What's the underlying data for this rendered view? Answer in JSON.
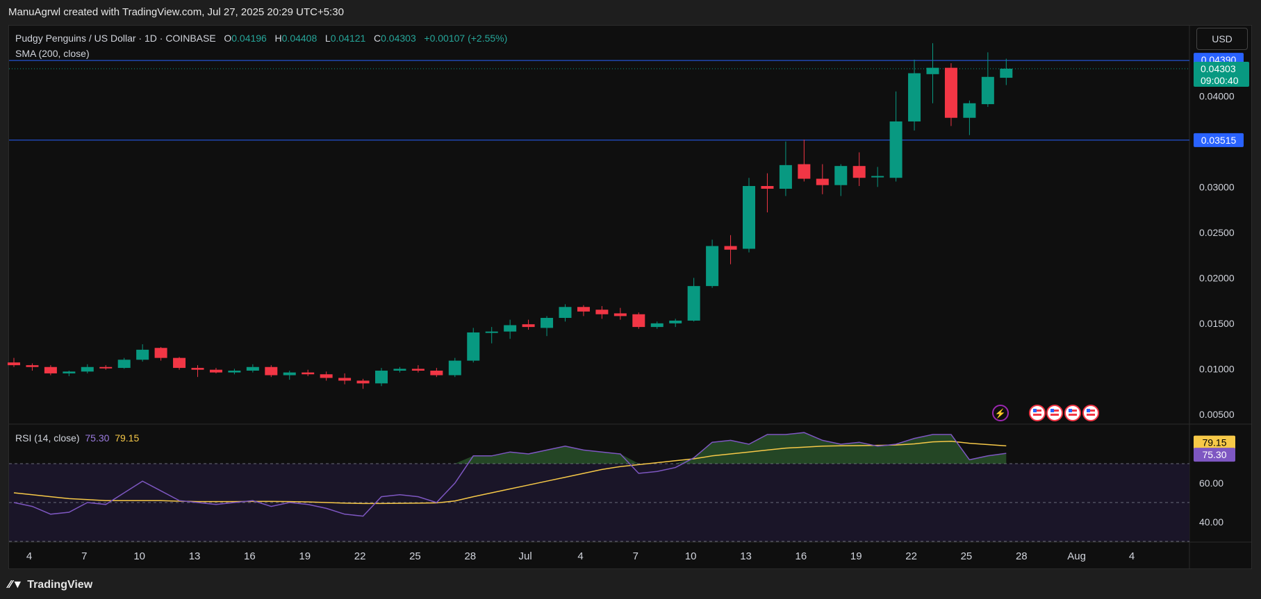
{
  "header": {
    "attribution": "ManuAgrwl created with TradingView.com, Jul 27, 2025 20:29 UTC+5:30"
  },
  "legend": {
    "symbol": "Pudgy Penguins / US Dollar · 1D · COINBASE",
    "o_label": "O",
    "o": "0.04196",
    "h_label": "H",
    "h": "0.04408",
    "l_label": "L",
    "l": "0.04121",
    "c_label": "C",
    "c": "0.04303",
    "change": "+0.00107 (+2.55%)",
    "sma": "SMA (200, close)"
  },
  "currency_button": "USD",
  "rsi_legend": {
    "label": "RSI (14, close)",
    "rsi": "75.30",
    "ma": "79.15"
  },
  "footer": {
    "brand": "TradingView"
  },
  "colors": {
    "up": "#089981",
    "down": "#f23645",
    "rsi_line": "#7e57c2",
    "rsi_ma": "#f7c948",
    "hline": "#2962ff"
  },
  "chart_data": [
    {
      "type": "candlestick",
      "x_ticks": [
        "4",
        "7",
        "10",
        "13",
        "16",
        "19",
        "22",
        "25",
        "28",
        "Jul",
        "4",
        "7",
        "10",
        "13",
        "16",
        "19",
        "22",
        "25",
        "28",
        "Aug",
        "4"
      ],
      "y_ticks": [
        "0.00500",
        "0.01000",
        "0.01500",
        "0.02000",
        "0.02500",
        "0.03000",
        "0.04000"
      ],
      "ylim": [
        0.004,
        0.0475
      ],
      "price_labels": {
        "level_high": "0.04390",
        "last": "0.04303",
        "countdown": "09:00:40",
        "level_low": "0.03515"
      },
      "horizontal_lines": [
        0.0439,
        0.03515
      ],
      "candles": [
        {
          "o": 0.0107,
          "h": 0.0112,
          "l": 0.0102,
          "c": 0.0104
        },
        {
          "o": 0.0104,
          "h": 0.0106,
          "l": 0.0098,
          "c": 0.0102
        },
        {
          "o": 0.0102,
          "h": 0.0104,
          "l": 0.0093,
          "c": 0.0095
        },
        {
          "o": 0.0095,
          "h": 0.0098,
          "l": 0.0092,
          "c": 0.0097
        },
        {
          "o": 0.0097,
          "h": 0.0105,
          "l": 0.0095,
          "c": 0.0102
        },
        {
          "o": 0.0102,
          "h": 0.0104,
          "l": 0.0099,
          "c": 0.0101
        },
        {
          "o": 0.0101,
          "h": 0.0112,
          "l": 0.01,
          "c": 0.011
        },
        {
          "o": 0.011,
          "h": 0.0127,
          "l": 0.0108,
          "c": 0.0121
        },
        {
          "o": 0.0123,
          "h": 0.0124,
          "l": 0.0109,
          "c": 0.0112
        },
        {
          "o": 0.0112,
          "h": 0.0113,
          "l": 0.0099,
          "c": 0.0101
        },
        {
          "o": 0.0101,
          "h": 0.0104,
          "l": 0.0091,
          "c": 0.0099
        },
        {
          "o": 0.0099,
          "h": 0.0101,
          "l": 0.0095,
          "c": 0.0096
        },
        {
          "o": 0.0096,
          "h": 0.01,
          "l": 0.0094,
          "c": 0.0098
        },
        {
          "o": 0.0098,
          "h": 0.0105,
          "l": 0.0096,
          "c": 0.0102
        },
        {
          "o": 0.0102,
          "h": 0.0104,
          "l": 0.0091,
          "c": 0.0093
        },
        {
          "o": 0.0093,
          "h": 0.0098,
          "l": 0.0088,
          "c": 0.0096
        },
        {
          "o": 0.0096,
          "h": 0.0099,
          "l": 0.0092,
          "c": 0.0094
        },
        {
          "o": 0.0094,
          "h": 0.0097,
          "l": 0.0087,
          "c": 0.009
        },
        {
          "o": 0.009,
          "h": 0.0095,
          "l": 0.0083,
          "c": 0.0087
        },
        {
          "o": 0.0087,
          "h": 0.0089,
          "l": 0.0078,
          "c": 0.0084
        },
        {
          "o": 0.0084,
          "h": 0.0101,
          "l": 0.0081,
          "c": 0.0098
        },
        {
          "o": 0.0098,
          "h": 0.0102,
          "l": 0.0096,
          "c": 0.01
        },
        {
          "o": 0.01,
          "h": 0.0104,
          "l": 0.0096,
          "c": 0.0098
        },
        {
          "o": 0.0098,
          "h": 0.0101,
          "l": 0.0091,
          "c": 0.0093
        },
        {
          "o": 0.0093,
          "h": 0.0112,
          "l": 0.0091,
          "c": 0.0109
        },
        {
          "o": 0.0109,
          "h": 0.0145,
          "l": 0.0107,
          "c": 0.014
        },
        {
          "o": 0.014,
          "h": 0.0146,
          "l": 0.0128,
          "c": 0.0141
        },
        {
          "o": 0.0141,
          "h": 0.0154,
          "l": 0.0133,
          "c": 0.0148
        },
        {
          "o": 0.0149,
          "h": 0.0154,
          "l": 0.0143,
          "c": 0.0146
        },
        {
          "o": 0.0145,
          "h": 0.0158,
          "l": 0.0136,
          "c": 0.0156
        },
        {
          "o": 0.0156,
          "h": 0.0171,
          "l": 0.0152,
          "c": 0.0168
        },
        {
          "o": 0.0168,
          "h": 0.017,
          "l": 0.0158,
          "c": 0.0163
        },
        {
          "o": 0.0165,
          "h": 0.0169,
          "l": 0.0155,
          "c": 0.016
        },
        {
          "o": 0.0161,
          "h": 0.0167,
          "l": 0.0154,
          "c": 0.0158
        },
        {
          "o": 0.016,
          "h": 0.0162,
          "l": 0.0144,
          "c": 0.0146
        },
        {
          "o": 0.0146,
          "h": 0.0152,
          "l": 0.0144,
          "c": 0.015
        },
        {
          "o": 0.015,
          "h": 0.0155,
          "l": 0.0146,
          "c": 0.0153
        },
        {
          "o": 0.0153,
          "h": 0.02,
          "l": 0.0152,
          "c": 0.0191
        },
        {
          "o": 0.0191,
          "h": 0.0242,
          "l": 0.0189,
          "c": 0.0235
        },
        {
          "o": 0.0235,
          "h": 0.0247,
          "l": 0.0215,
          "c": 0.0231
        },
        {
          "o": 0.0232,
          "h": 0.031,
          "l": 0.0228,
          "c": 0.0301
        },
        {
          "o": 0.0301,
          "h": 0.0315,
          "l": 0.0272,
          "c": 0.0298
        },
        {
          "o": 0.0298,
          "h": 0.035,
          "l": 0.029,
          "c": 0.0324
        },
        {
          "o": 0.0325,
          "h": 0.0352,
          "l": 0.0306,
          "c": 0.0309
        },
        {
          "o": 0.0309,
          "h": 0.0325,
          "l": 0.0292,
          "c": 0.0302
        },
        {
          "o": 0.0302,
          "h": 0.0325,
          "l": 0.029,
          "c": 0.0323
        },
        {
          "o": 0.0323,
          "h": 0.0338,
          "l": 0.0301,
          "c": 0.031
        },
        {
          "o": 0.0311,
          "h": 0.0322,
          "l": 0.03,
          "c": 0.0312
        },
        {
          "o": 0.031,
          "h": 0.0405,
          "l": 0.0306,
          "c": 0.0372
        },
        {
          "o": 0.0372,
          "h": 0.044,
          "l": 0.0362,
          "c": 0.0425
        },
        {
          "o": 0.0424,
          "h": 0.0458,
          "l": 0.0392,
          "c": 0.0431
        },
        {
          "o": 0.0431,
          "h": 0.0436,
          "l": 0.0367,
          "c": 0.0376
        },
        {
          "o": 0.0376,
          "h": 0.0395,
          "l": 0.0357,
          "c": 0.0392
        },
        {
          "o": 0.0391,
          "h": 0.0448,
          "l": 0.0388,
          "c": 0.0421
        },
        {
          "o": 0.042,
          "h": 0.0441,
          "l": 0.0412,
          "c": 0.043
        }
      ]
    },
    {
      "type": "line",
      "title": "RSI (14, close)",
      "y_ticks": [
        "40.00",
        "60.00"
      ],
      "ylim": [
        30,
        90
      ],
      "bands": [
        70,
        50,
        30
      ],
      "labels": {
        "ma": "79.15",
        "rsi": "75.30"
      },
      "series": [
        {
          "name": "RSI",
          "values": [
            50,
            48,
            44,
            45,
            50,
            49,
            55,
            61,
            56,
            51,
            50,
            49,
            50,
            51,
            48,
            50,
            49,
            47,
            44,
            43,
            53,
            54,
            53,
            50,
            60,
            74,
            74,
            76,
            75,
            77,
            79,
            77,
            76,
            75,
            65,
            66,
            68,
            73,
            81,
            82,
            80,
            85,
            85,
            86,
            82,
            80,
            81,
            79,
            80,
            83,
            85,
            85,
            72,
            74,
            75.3
          ]
        },
        {
          "name": "RSI-based MA",
          "values": [
            55,
            54,
            53,
            52,
            51.5,
            51,
            51,
            51,
            51,
            50.7,
            50.5,
            50.5,
            50.5,
            50.6,
            50.6,
            50.5,
            50.3,
            50,
            49.7,
            49.5,
            49.5,
            49.6,
            49.7,
            49.8,
            50.8,
            53,
            55,
            57,
            59,
            61,
            63,
            65,
            67,
            68.5,
            69.5,
            70.5,
            71.5,
            72.5,
            74,
            75,
            76,
            77,
            78,
            78.5,
            79,
            79.2,
            79.3,
            79.4,
            79.6,
            80.2,
            81.2,
            81.5,
            80.5,
            79.8,
            79.15
          ]
        }
      ]
    }
  ]
}
